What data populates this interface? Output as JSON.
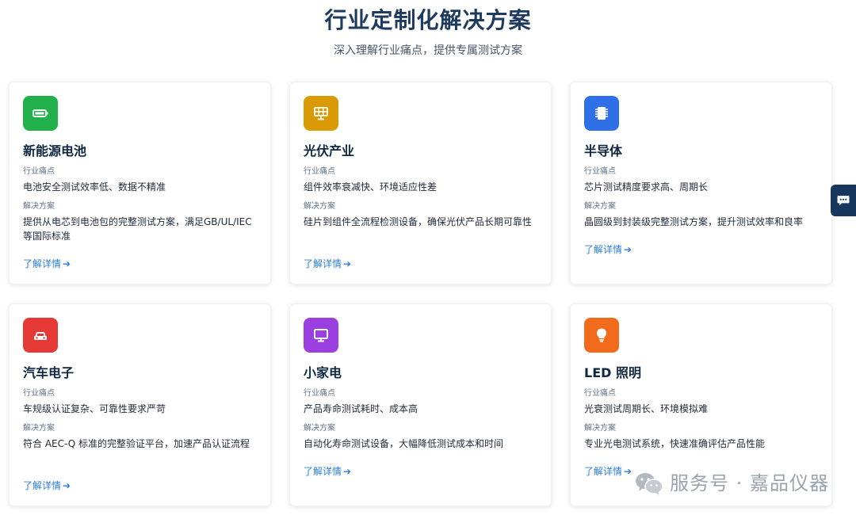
{
  "header": {
    "title": "行业定制化解决方案",
    "subtitle": "深入理解行业痛点，提供专属测试方案"
  },
  "labels": {
    "pain": "行业痛点",
    "solution": "解决方案",
    "more": "了解详情"
  },
  "cards": [
    {
      "title": "新能源电池",
      "pain": "电池安全测试效率低、数据不精准",
      "solution": "提供从电芯到电池包的完整测试方案，满足GB/UL/IEC 等国际标准",
      "icon": "battery-icon",
      "color": "#22b04b"
    },
    {
      "title": "光伏产业",
      "pain": "组件效率衰减快、环境适应性差",
      "solution": "硅片到组件全流程检测设备，确保光伏产品长期可靠性",
      "icon": "solar-panel-icon",
      "color": "#d99a06"
    },
    {
      "title": "半导体",
      "pain": "芯片测试精度要求高、周期长",
      "solution": "晶圆级到封装级完整测试方案，提升测试效率和良率",
      "icon": "chip-icon",
      "color": "#2f6fe8"
    },
    {
      "title": "汽车电子",
      "pain": "车规级认证复杂、可靠性要求严苛",
      "solution": "符合 AEC-Q 标准的完整验证平台，加速产品认证流程",
      "icon": "car-icon",
      "color": "#e53935"
    },
    {
      "title": "小家电",
      "pain": "产品寿命测试耗时、成本高",
      "solution": "自动化寿命测试设备，大幅降低测试成本和时间",
      "icon": "monitor-icon",
      "color": "#9b3fe0"
    },
    {
      "title": "LED 照明",
      "pain": "光衰测试周期长、环境模拟难",
      "solution": "专业光电测试系统，快速准确评估产品性能",
      "icon": "lightbulb-icon",
      "color": "#f26a1b"
    }
  ],
  "watermark": {
    "text": "服务号 · 嘉品仪器",
    "icon": "wechat-icon"
  },
  "chat": {
    "icon": "chat-icon"
  }
}
